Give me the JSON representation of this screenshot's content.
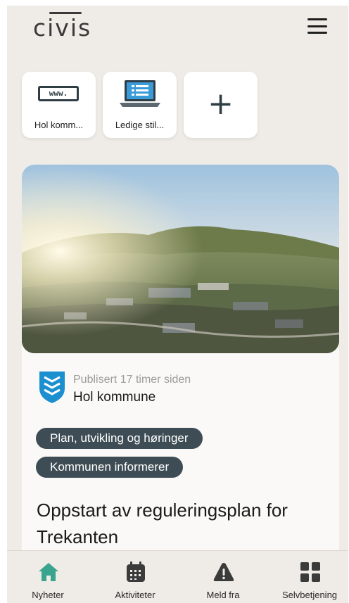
{
  "app": {
    "logo_text": "civis"
  },
  "shortcuts": [
    {
      "label": "Hol komm...",
      "icon": "www-icon",
      "icon_text": "www."
    },
    {
      "label": "Ledige stil...",
      "icon": "laptop-icon"
    },
    {
      "label": "",
      "icon": "plus-icon",
      "symbol": "+"
    }
  ],
  "news": {
    "published": "Publisert 17 timer siden",
    "publisher": "Hol kommune",
    "tags": [
      "Plan, utvikling og høringer",
      "Kommunen informerer"
    ],
    "headline": "Oppstart av reguleringsplan for Trekanten"
  },
  "nav": {
    "items": [
      {
        "label": "Nyheter",
        "icon": "house-icon",
        "active": true
      },
      {
        "label": "Aktiviteter",
        "icon": "calendar-icon",
        "active": false
      },
      {
        "label": "Meld fra",
        "icon": "warning-icon",
        "active": false
      },
      {
        "label": "Selvbetjening",
        "icon": "grid-icon",
        "active": false
      }
    ]
  },
  "colors": {
    "background": "#efebe6",
    "tag_bg": "#3e4d55",
    "accent_active": "#3aa48e",
    "icon_dark": "#2f3d45"
  }
}
